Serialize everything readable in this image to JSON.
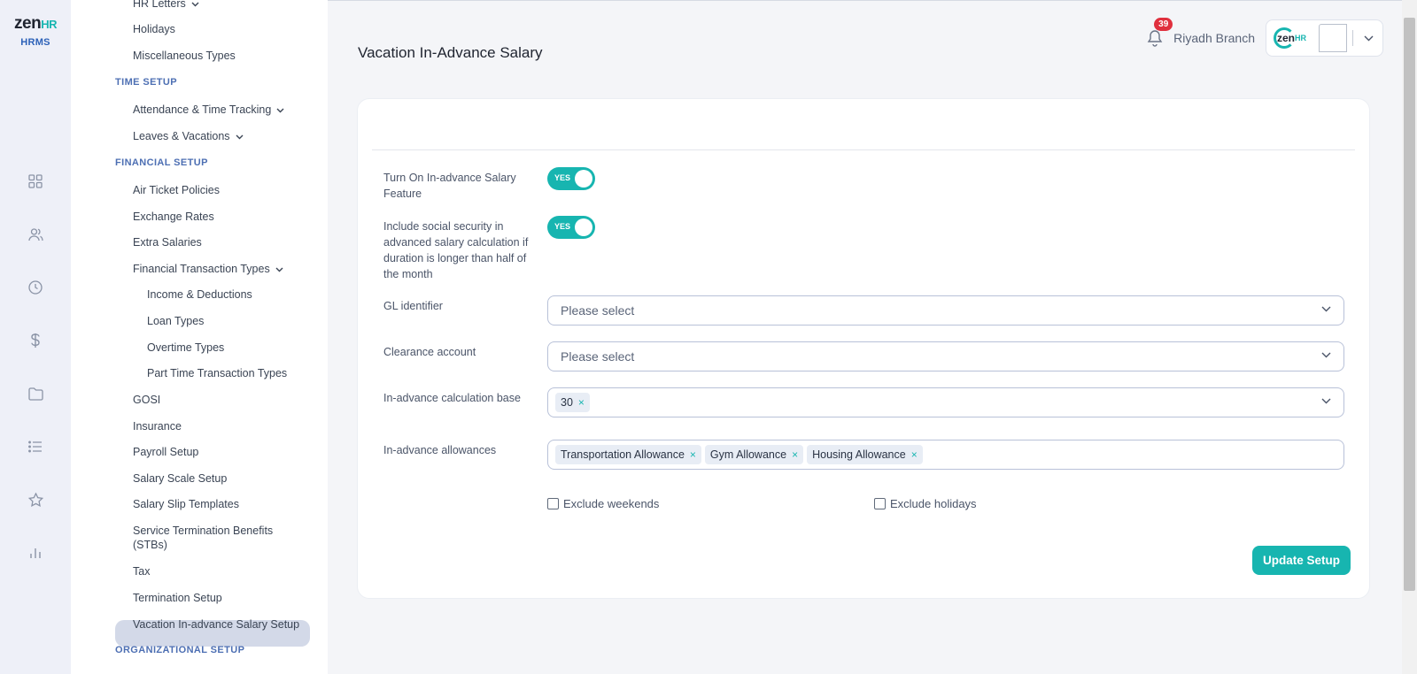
{
  "brand": {
    "word": "zen",
    "suffix": "HR",
    "product": "HRMS"
  },
  "rail_icons": [
    "dashboard-icon",
    "people-icon",
    "clock-icon",
    "dollar-icon",
    "folder-icon",
    "list-icon",
    "star-icon",
    "bar-chart-icon"
  ],
  "subnav": {
    "items": [
      {
        "label": "HR Letters",
        "type": "item"
      },
      {
        "label": "Holidays",
        "type": "item"
      },
      {
        "label": "Miscellaneous Types",
        "type": "item"
      },
      {
        "label": "TIME SETUP",
        "type": "section"
      },
      {
        "label": "Attendance & Time Tracking",
        "type": "item"
      },
      {
        "label": "Leaves & Vacations",
        "type": "item"
      },
      {
        "label": "FINANCIAL SETUP",
        "type": "section"
      },
      {
        "label": "Air Ticket Policies",
        "type": "item"
      },
      {
        "label": "Exchange Rates",
        "type": "item"
      },
      {
        "label": "Extra Salaries",
        "type": "item"
      },
      {
        "label": "Financial Transaction Types",
        "type": "item"
      },
      {
        "label": "Income & Deductions",
        "type": "sub"
      },
      {
        "label": "Loan Types",
        "type": "sub"
      },
      {
        "label": "Overtime Types",
        "type": "sub"
      },
      {
        "label": "Part Time Transaction Types",
        "type": "sub"
      },
      {
        "label": "GOSI",
        "type": "item"
      },
      {
        "label": "Insurance",
        "type": "item"
      },
      {
        "label": "Payroll Setup",
        "type": "item"
      },
      {
        "label": "Salary Scale Setup",
        "type": "item"
      },
      {
        "label": "Salary Slip Templates",
        "type": "item"
      },
      {
        "label": "Service Termination Benefits",
        "type": "item"
      },
      {
        "label": "(STBs)",
        "type": "item"
      },
      {
        "label": "Tax",
        "type": "item"
      },
      {
        "label": "Termination Setup",
        "type": "item"
      },
      {
        "label": "Vacation In-advance Salary Setup",
        "type": "active"
      },
      {
        "label": "ORGANIZATIONAL SETUP",
        "type": "section"
      }
    ]
  },
  "header": {
    "title": "Vacation In-Advance Salary",
    "notification_count": "39",
    "branch": "Riyadh Branch"
  },
  "form": {
    "toggle1": {
      "label": "Turn On In-advance Salary Feature",
      "state": "YES"
    },
    "toggle2": {
      "label": "Include social security in advanced salary calculation if duration is longer than half of the month",
      "state": "YES"
    },
    "gl": {
      "label": "GL identifier",
      "placeholder": "Please select"
    },
    "clearance": {
      "label": "Clearance account",
      "placeholder": "Please select"
    },
    "calc_base": {
      "label": "In-advance calculation base",
      "tags": [
        "30"
      ]
    },
    "allowances": {
      "label": "In-advance allowances",
      "tags": [
        "Transportation Allowance",
        "Gym Allowance",
        "Housing Allowance"
      ]
    },
    "exclude_weekends": "Exclude weekends",
    "exclude_holidays": "Exclude holidays",
    "submit": "Update Setup"
  },
  "colors": {
    "accent": "#17b5b0",
    "badge": "#e0303e",
    "rail_bg": "#eef0f8",
    "section": "#4d6fb3"
  }
}
